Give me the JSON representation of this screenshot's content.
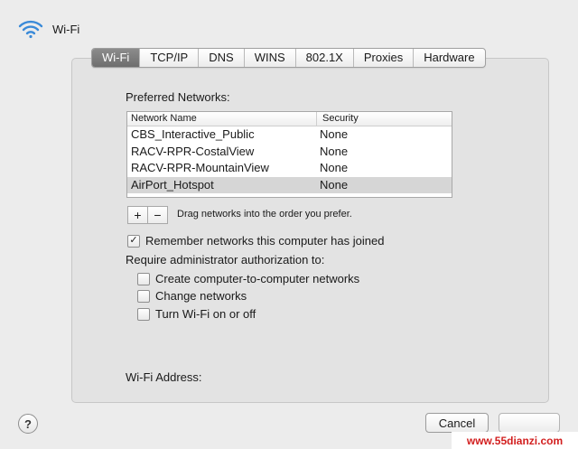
{
  "header": {
    "title": "Wi-Fi",
    "icon": "wifi-icon"
  },
  "tabs": [
    {
      "label": "Wi-Fi",
      "active": true
    },
    {
      "label": "TCP/IP",
      "active": false
    },
    {
      "label": "DNS",
      "active": false
    },
    {
      "label": "WINS",
      "active": false
    },
    {
      "label": "802.1X",
      "active": false
    },
    {
      "label": "Proxies",
      "active": false
    },
    {
      "label": "Hardware",
      "active": false
    }
  ],
  "preferred": {
    "label": "Preferred Networks:",
    "columns": {
      "name": "Network Name",
      "security": "Security"
    },
    "rows": [
      {
        "name": "CBS_Interactive_Public",
        "security": "None",
        "selected": false
      },
      {
        "name": "RACV-RPR-CostalView",
        "security": "None",
        "selected": false
      },
      {
        "name": "RACV-RPR-MountainView",
        "security": "None",
        "selected": false
      },
      {
        "name": "AirPort_Hotspot",
        "security": "None",
        "selected": true
      }
    ],
    "add_label": "+",
    "remove_label": "−",
    "hint": "Drag networks into the order you prefer."
  },
  "remember": {
    "label": "Remember networks this computer has joined",
    "checked": true,
    "mark": "✓"
  },
  "admin": {
    "label": "Require administrator authorization to:",
    "options": [
      {
        "label": "Create computer-to-computer networks",
        "checked": false
      },
      {
        "label": "Change networks",
        "checked": false
      },
      {
        "label": "Turn Wi-Fi on or off",
        "checked": false
      }
    ]
  },
  "address": {
    "label": "Wi-Fi Address:"
  },
  "footer": {
    "help_label": "?",
    "cancel_label": "Cancel"
  },
  "watermark": {
    "text": "www.55dianzi.com"
  },
  "colors": {
    "selected_row": "#d6d6d6",
    "active_tab": "#7a7a7a",
    "watermark": "#d21f1f"
  }
}
